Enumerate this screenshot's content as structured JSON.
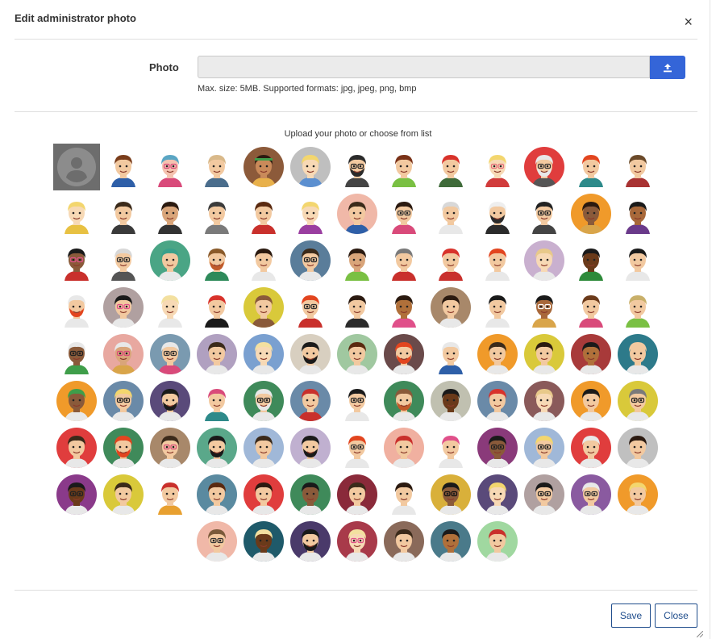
{
  "dialog": {
    "title": "Edit administrator photo",
    "close_glyph": "×"
  },
  "photo": {
    "label": "Photo",
    "hint": "Max. size: 5MB. Supported formats: jpg, jpeg, png, bmp",
    "upload_icon": "upload-icon"
  },
  "gallery": {
    "caption": "Upload your photo or choose from list",
    "row_counts": [
      13,
      13,
      13,
      13,
      13,
      13,
      13,
      13,
      7
    ],
    "avatars": [
      {
        "frame": "none",
        "bg": "#6d6d6d",
        "skin": "#ffffff",
        "hair": "#ffffff",
        "shirt": "#ffffff",
        "default": true
      },
      {
        "frame": "none",
        "bg": "#ffffff",
        "skin": "#f2c9a0",
        "hair": "#7a3d1b",
        "shirt": "#2e5fa8"
      },
      {
        "frame": "none",
        "bg": "#ffffff",
        "skin": "#f5c2b0",
        "hair": "#5aa6c4",
        "shirt": "#d94a7a",
        "glasses": "#d94a7a"
      },
      {
        "frame": "none",
        "bg": "#ffffff",
        "skin": "#f2c9a0",
        "hair": "#d9b98a",
        "shirt": "#4a6d8c"
      },
      {
        "frame": "circle",
        "bg": "#8c5a3a",
        "skin": "#c98a5a",
        "hair": "#2b1a10",
        "shirt": "#e8b04a",
        "band": "#3f9e4a"
      },
      {
        "frame": "circle",
        "bg": "#bfbfbf",
        "skin": "#f7d9b5",
        "hair": "#f3d66e",
        "shirt": "#5b8fd0"
      },
      {
        "frame": "none",
        "bg": "#ffffff",
        "skin": "#f2c9a0",
        "hair": "#2b2b2b",
        "shirt": "#444444",
        "beard": "#2b2b2b",
        "glasses": "#222222"
      },
      {
        "frame": "none",
        "bg": "#ffffff",
        "skin": "#f2c9a0",
        "hair": "#7a3218",
        "shirt": "#7ac043"
      },
      {
        "frame": "none",
        "bg": "#ffffff",
        "skin": "#f2c9a0",
        "hair": "#d8322b",
        "shirt": "#3f6b3a"
      },
      {
        "frame": "none",
        "bg": "#ffffff",
        "skin": "#f7d9b5",
        "hair": "#f3d66e",
        "shirt": "#d13b3b",
        "glasses": "#e66e7a"
      },
      {
        "frame": "circle",
        "bg": "#e03d3d",
        "skin": "#f2c9a0",
        "hair": "#e8e8e8",
        "shirt": "#555555",
        "glasses": "#333333",
        "beard": "#e8e8e8"
      },
      {
        "frame": "none",
        "bg": "#ffffff",
        "skin": "#f2c9a0",
        "hair": "#e2451f",
        "shirt": "#2d8a8a"
      },
      {
        "frame": "none",
        "bg": "#ffffff",
        "skin": "#f2c9a0",
        "hair": "#6b4a2a",
        "shirt": "#a83232"
      },
      {
        "frame": "none",
        "bg": "#ffffff",
        "skin": "#f7d9b5",
        "hair": "#f3d66e",
        "shirt": "#e8c142"
      },
      {
        "frame": "none",
        "bg": "#ffffff",
        "skin": "#f2c9a0",
        "hair": "#3b2a1a",
        "shirt": "#3a3a3a"
      },
      {
        "frame": "none",
        "bg": "#ffffff",
        "skin": "#d9a57a",
        "hair": "#2b1a10",
        "shirt": "#333333"
      },
      {
        "frame": "none",
        "bg": "#ffffff",
        "skin": "#f2c9a0",
        "hair": "#3b3b3b",
        "shirt": "#7a7a7a"
      },
      {
        "frame": "none",
        "bg": "#ffffff",
        "skin": "#f2c9a0",
        "hair": "#5a2a10",
        "shirt": "#c9302c"
      },
      {
        "frame": "none",
        "bg": "#ffffff",
        "skin": "#f7d9b5",
        "hair": "#f3d66e",
        "shirt": "#9a3ea0"
      },
      {
        "frame": "circle",
        "bg": "#f0b8a8",
        "skin": "#f2c9a0",
        "hair": "#3b2a1a",
        "shirt": "#2e5fa8"
      },
      {
        "frame": "none",
        "bg": "#ffffff",
        "skin": "#f2c9a0",
        "hair": "#2b1a10",
        "shirt": "#d94a7a",
        "glasses": "#333333"
      },
      {
        "frame": "none",
        "bg": "#ffffff",
        "skin": "#f2c9a0",
        "hair": "#d8d8d8",
        "shirt": "#e8e8e8"
      },
      {
        "frame": "none",
        "bg": "#ffffff",
        "skin": "#f2c9a0",
        "hair": "#eeeeee",
        "shirt": "#2b2b2b",
        "beard": "#2b2b2b"
      },
      {
        "frame": "none",
        "bg": "#ffffff",
        "skin": "#f2c9a0",
        "hair": "#222222",
        "shirt": "#444444",
        "glasses": "#222222"
      },
      {
        "frame": "circle",
        "bg": "#f09a2a",
        "skin": "#8a5a3a",
        "hair": "#2b1a10",
        "shirt": "#d9a54a"
      },
      {
        "frame": "none",
        "bg": "#ffffff",
        "skin": "#a8683a",
        "hair": "#1a1a1a",
        "shirt": "#6a3a8a"
      },
      {
        "frame": "none",
        "bg": "#ffffff",
        "skin": "#8a5a3a",
        "hair": "#1a1a1a",
        "shirt": "#c9302c",
        "glasses": "#e0508a"
      },
      {
        "frame": "none",
        "bg": "#ffffff",
        "skin": "#f2c9a0",
        "hair": "#d8d8d8",
        "shirt": "#555555",
        "glasses": "#333333"
      },
      {
        "frame": "circle",
        "bg": "#4aa585",
        "skin": "#f2c9a0",
        "hair": "#3aa08a",
        "shirt": "#e8e8e8"
      },
      {
        "frame": "none",
        "bg": "#ffffff",
        "skin": "#f2c9a0",
        "hair": "#8a5a2a",
        "shirt": "#2e8a5a",
        "beard": "#c05a2a"
      },
      {
        "frame": "none",
        "bg": "#ffffff",
        "skin": "#f2c9a0",
        "hair": "#2b1a10",
        "shirt": "#e8e8e8"
      },
      {
        "frame": "circle",
        "bg": "#5a7d9a",
        "skin": "#f2c9a0",
        "hair": "#3b2a1a",
        "shirt": "#e8e8e8",
        "glasses": "#222222"
      },
      {
        "frame": "none",
        "bg": "#ffffff",
        "skin": "#d9a57a",
        "hair": "#2b1a10",
        "shirt": "#7ac043"
      },
      {
        "frame": "none",
        "bg": "#ffffff",
        "skin": "#f2c9a0",
        "hair": "#7a7a7a",
        "shirt": "#c9302c"
      },
      {
        "frame": "none",
        "bg": "#ffffff",
        "skin": "#f2c9a0",
        "hair": "#d8322b",
        "shirt": "#c9302c"
      },
      {
        "frame": "none",
        "bg": "#ffffff",
        "skin": "#f2c9a0",
        "hair": "#e2451f",
        "shirt": "#e8e8e8"
      },
      {
        "frame": "circle",
        "bg": "#c9b0cf",
        "skin": "#f7d9b5",
        "hair": "#e8c98a",
        "shirt": "#e8e8e8"
      },
      {
        "frame": "none",
        "bg": "#ffffff",
        "skin": "#6a3a1a",
        "hair": "#1a1a1a",
        "shirt": "#2e8a3a"
      },
      {
        "frame": "none",
        "bg": "#ffffff",
        "skin": "#f2c9a0",
        "hair": "#1a1a1a",
        "shirt": "#e8e8e8"
      },
      {
        "frame": "none",
        "bg": "#ffffff",
        "skin": "#f2c9a0",
        "hair": "#e8e8e8",
        "shirt": "#e8e8e8",
        "beard": "#e2451f"
      },
      {
        "frame": "circle",
        "bg": "#b0a0a0",
        "skin": "#f2c9a0",
        "hair": "#1a1a1a",
        "shirt": "#e8e8e8",
        "glasses": "#e0508a"
      },
      {
        "frame": "none",
        "bg": "#ffffff",
        "skin": "#f7d9b5",
        "hair": "#f3e0a0",
        "shirt": "#e8e8e8"
      },
      {
        "frame": "none",
        "bg": "#ffffff",
        "skin": "#f2c9a0",
        "hair": "#d8322b",
        "shirt": "#1a1a1a"
      },
      {
        "frame": "circle",
        "bg": "#d9c93a",
        "skin": "#f2c9a0",
        "hair": "#8a5a3a",
        "shirt": "#8a5a3a"
      },
      {
        "frame": "none",
        "bg": "#ffffff",
        "skin": "#f2c9a0",
        "hair": "#e2451f",
        "shirt": "#c9302c",
        "glasses": "#333333"
      },
      {
        "frame": "none",
        "bg": "#ffffff",
        "skin": "#f2c9a0",
        "hair": "#2b1a10",
        "shirt": "#2b2b2b"
      },
      {
        "frame": "none",
        "bg": "#ffffff",
        "skin": "#b0703a",
        "hair": "#2b1a10",
        "shirt": "#e0508a"
      },
      {
        "frame": "circle",
        "bg": "#a8886a",
        "skin": "#f2c9a0",
        "hair": "#2b1a10",
        "shirt": "#e8e8e8"
      },
      {
        "frame": "none",
        "bg": "#ffffff",
        "skin": "#f2c9a0",
        "hair": "#1a1a1a",
        "shirt": "#e8e8e8"
      },
      {
        "frame": "none",
        "bg": "#ffffff",
        "skin": "#a8683a",
        "hair": "#1a1a1a",
        "shirt": "#d9a54a",
        "glasses": "#ffffff"
      },
      {
        "frame": "none",
        "bg": "#ffffff",
        "skin": "#f2c9a0",
        "hair": "#6b3a1a",
        "shirt": "#d94a7a"
      },
      {
        "frame": "none",
        "bg": "#ffffff",
        "skin": "#f2c9a0",
        "hair": "#c9b06a",
        "shirt": "#7ac043"
      },
      {
        "frame": "none",
        "bg": "#ffffff",
        "skin": "#8a5a3a",
        "hair": "#e8e8e8",
        "shirt": "#3f9e4a",
        "glasses": "#222222"
      },
      {
        "frame": "circle",
        "bg": "#e8a8a0",
        "skin": "#d9a57a",
        "hair": "#e8e8e8",
        "shirt": "#d9a54a",
        "glasses": "#d94a7a"
      },
      {
        "frame": "circle",
        "bg": "#7a9ab0",
        "skin": "#f2c9a0",
        "hair": "#e8e8e8",
        "shirt": "#d94a7a",
        "glasses": "#333333"
      },
      {
        "frame": "circle",
        "bg": "#b0a0c0",
        "skin": "#f2c9a0",
        "hair": "#3b2a1a",
        "shirt": "#e8e8e8"
      },
      {
        "frame": "circle",
        "bg": "#7aa0d0",
        "skin": "#f7d9b5",
        "hair": "#f3e0a0",
        "shirt": "#e8e8e8"
      },
      {
        "frame": "circle",
        "bg": "#d8cfc0",
        "skin": "#f2c9a0",
        "hair": "#1a1a1a",
        "shirt": "#e8e8e8",
        "beard": "#1a1a1a"
      },
      {
        "frame": "circle",
        "bg": "#a0c8a0",
        "skin": "#f2c9a0",
        "hair": "#5a2a10",
        "shirt": "#e8e8e8"
      },
      {
        "frame": "circle",
        "bg": "#6a4a4a",
        "skin": "#f2c9a0",
        "hair": "#e2451f",
        "shirt": "#e8e8e8",
        "beard": "#e2451f"
      },
      {
        "frame": "none",
        "bg": "#ffffff",
        "skin": "#f2c9a0",
        "hair": "#e8e8e8",
        "shirt": "#2e5fa8"
      },
      {
        "frame": "circle",
        "bg": "#f09a2a",
        "skin": "#f2c9a0",
        "hair": "#3b2a1a",
        "shirt": "#e8e8e8"
      },
      {
        "frame": "circle",
        "bg": "#d9c93a",
        "skin": "#f2c9a0",
        "hair": "#2b1a10",
        "shirt": "#e8e8e8"
      },
      {
        "frame": "circle",
        "bg": "#a83a3a",
        "skin": "#b0703a",
        "hair": "#1a1a1a",
        "shirt": "#e8e8e8"
      },
      {
        "frame": "circle",
        "bg": "#2d7a8a",
        "skin": "#f2c9a0",
        "hair": "#f2c9a0",
        "shirt": "#e8e8e8"
      },
      {
        "frame": "circle",
        "bg": "#f09a2a",
        "skin": "#8a5a3a",
        "hair": "#3f9e4a",
        "shirt": "#e8e8e8"
      },
      {
        "frame": "circle",
        "bg": "#6a8aa8",
        "skin": "#f2c9a0",
        "hair": "#f3d66e",
        "shirt": "#e8e8e8",
        "glasses": "#222222"
      },
      {
        "frame": "circle",
        "bg": "#5a4a7a",
        "skin": "#f2c9a0",
        "hair": "#1a1a1a",
        "shirt": "#e8e8e8",
        "beard": "#1a1a1a"
      },
      {
        "frame": "none",
        "bg": "#ffffff",
        "skin": "#f2c9a0",
        "hair": "#d94a7a",
        "shirt": "#2e8a8a"
      },
      {
        "frame": "circle",
        "bg": "#3f8a5a",
        "skin": "#f2c9a0",
        "hair": "#e8e8e8",
        "shirt": "#e8e8e8",
        "glasses": "#222222",
        "beard": "#e8e8e8"
      },
      {
        "frame": "circle",
        "bg": "#6a8aa8",
        "skin": "#f2c9a0",
        "hair": "#c9302c",
        "shirt": "#c9302c"
      },
      {
        "frame": "none",
        "bg": "#ffffff",
        "skin": "#f2c9a0",
        "hair": "#1a1a1a",
        "shirt": "#e8e8e8",
        "glasses": "#222222"
      },
      {
        "frame": "circle",
        "bg": "#3f8a5a",
        "skin": "#f2c9a0",
        "hair": "#8a5a3a",
        "shirt": "#e8e8e8",
        "beard": "#c05a2a"
      },
      {
        "frame": "circle",
        "bg": "#c0c0b0",
        "skin": "#6a3a1a",
        "hair": "#1a1a1a",
        "shirt": "#e8e8e8"
      },
      {
        "frame": "circle",
        "bg": "#6a8aa8",
        "skin": "#f2c9a0",
        "hair": "#d8322b",
        "shirt": "#e8e8e8"
      },
      {
        "frame": "circle",
        "bg": "#8a5a5a",
        "skin": "#f7d9b5",
        "hair": "#e8c98a",
        "shirt": "#e8e8e8"
      },
      {
        "frame": "circle",
        "bg": "#f09a2a",
        "skin": "#f2c9a0",
        "hair": "#1a1a1a",
        "shirt": "#e8e8e8"
      },
      {
        "frame": "circle",
        "bg": "#d9c93a",
        "skin": "#f2c9a0",
        "hair": "#7a7a7a",
        "shirt": "#e8e8e8",
        "glasses": "#222222"
      },
      {
        "frame": "circle",
        "bg": "#e03d3d",
        "skin": "#f2c9a0",
        "hair": "#3b2a1a",
        "shirt": "#e8e8e8"
      },
      {
        "frame": "circle",
        "bg": "#3f8a5a",
        "skin": "#f2c9a0",
        "hair": "#e2451f",
        "shirt": "#e8e8e8",
        "beard": "#e2451f"
      },
      {
        "frame": "circle",
        "bg": "#a8886a",
        "skin": "#f2c9a0",
        "hair": "#3b2a1a",
        "shirt": "#e8e8e8",
        "glasses": "#d94a7a"
      },
      {
        "frame": "circle",
        "bg": "#5aa88a",
        "skin": "#f2c9a0",
        "hair": "#1a1a1a",
        "shirt": "#e8e8e8",
        "beard": "#1a1a1a"
      },
      {
        "frame": "circle",
        "bg": "#a0b8d8",
        "skin": "#f2c9a0",
        "hair": "#3b2a1a",
        "shirt": "#e8e8e8"
      },
      {
        "frame": "circle",
        "bg": "#c0b0d0",
        "skin": "#f2c9a0",
        "hair": "#1a1a1a",
        "shirt": "#e8e8e8",
        "beard": "#1a1a1a"
      },
      {
        "frame": "none",
        "bg": "#ffffff",
        "skin": "#f2c9a0",
        "hair": "#e2451f",
        "shirt": "#e8e8e8",
        "glasses": "#333333"
      },
      {
        "frame": "circle",
        "bg": "#f0b0a0",
        "skin": "#f2c9a0",
        "hair": "#c9302c",
        "shirt": "#e8e8e8"
      },
      {
        "frame": "none",
        "bg": "#ffffff",
        "skin": "#f2c9a0",
        "hair": "#e0508a",
        "shirt": "#e8e8e8"
      },
      {
        "frame": "circle",
        "bg": "#8a3a7a",
        "skin": "#8a5a3a",
        "hair": "#1a1a1a",
        "shirt": "#e8e8e8",
        "glasses": "#222222"
      },
      {
        "frame": "circle",
        "bg": "#a0b8d8",
        "skin": "#f2c9a0",
        "hair": "#f3d66e",
        "shirt": "#e8e8e8",
        "glasses": "#222222"
      },
      {
        "frame": "circle",
        "bg": "#e03d3d",
        "skin": "#f2c9a0",
        "hair": "#e8e8e8",
        "shirt": "#e8e8e8"
      },
      {
        "frame": "circle",
        "bg": "#c0c0c0",
        "skin": "#f2c9a0",
        "hair": "#2b1a10",
        "shirt": "#e8e8e8"
      },
      {
        "frame": "circle",
        "bg": "#8a3a8a",
        "skin": "#6a3a1a",
        "hair": "#1a1a1a",
        "shirt": "#e8e8e8",
        "glasses": "#222222"
      },
      {
        "frame": "circle",
        "bg": "#d9c93a",
        "skin": "#f2c9a0",
        "hair": "#3b2a1a",
        "shirt": "#e8e8e8"
      },
      {
        "frame": "none",
        "bg": "#ffffff",
        "skin": "#f2c9a0",
        "hair": "#c9302c",
        "shirt": "#e8a030"
      },
      {
        "frame": "circle",
        "bg": "#5a8aa0",
        "skin": "#f2c9a0",
        "hair": "#5a2a10",
        "shirt": "#e8e8e8"
      },
      {
        "frame": "circle",
        "bg": "#e03d3d",
        "skin": "#f2c9a0",
        "hair": "#2b1a10",
        "shirt": "#e8e8e8"
      },
      {
        "frame": "circle",
        "bg": "#3f8a5a",
        "skin": "#8a5a3a",
        "hair": "#1a1a1a",
        "shirt": "#e8e8e8"
      },
      {
        "frame": "circle",
        "bg": "#8a2a3a",
        "skin": "#f2c9a0",
        "hair": "#3b2a1a",
        "shirt": "#e8e8e8"
      },
      {
        "frame": "none",
        "bg": "#ffffff",
        "skin": "#f2c9a0",
        "hair": "#2b1a10",
        "shirt": "#e8e8e8"
      },
      {
        "frame": "circle",
        "bg": "#d9b03a",
        "skin": "#8a5a3a",
        "hair": "#1a1a1a",
        "shirt": "#e8e8e8",
        "glasses": "#111111"
      },
      {
        "frame": "circle",
        "bg": "#5a4a7a",
        "skin": "#f7d9b5",
        "hair": "#f3d66e",
        "shirt": "#e8e8e8"
      },
      {
        "frame": "circle",
        "bg": "#b0a0a0",
        "skin": "#f2c9a0",
        "hair": "#1a1a1a",
        "shirt": "#e8e8e8",
        "glasses": "#222222"
      },
      {
        "frame": "circle",
        "bg": "#8a5aa0",
        "skin": "#f2c9a0",
        "hair": "#e8e8e8",
        "shirt": "#e8e8e8",
        "glasses": "#333333"
      },
      {
        "frame": "circle",
        "bg": "#f09a2a",
        "skin": "#f2c9a0",
        "hair": "#f3d66e",
        "shirt": "#e8e8e8"
      },
      {
        "frame": "circle",
        "bg": "#f0b8a8",
        "skin": "#f2c9a0",
        "hair": "#7a5a3a",
        "shirt": "#e8e8e8",
        "glasses": "#333333"
      },
      {
        "frame": "circle",
        "bg": "#1f5a6a",
        "skin": "#6a3a1a",
        "hair": "#f3e0a0",
        "shirt": "#e8e8e8"
      },
      {
        "frame": "circle",
        "bg": "#4a3a6a",
        "skin": "#f2c9a0",
        "hair": "#1a1a1a",
        "shirt": "#e8e8e8",
        "beard": "#1a1a1a"
      },
      {
        "frame": "circle",
        "bg": "#a83a4a",
        "skin": "#f7d9b5",
        "hair": "#f3e0a0",
        "shirt": "#e8e8e8",
        "glasses": "#e0508a"
      },
      {
        "frame": "circle",
        "bg": "#8a6a5a",
        "skin": "#f2c9a0",
        "hair": "#3b2a1a",
        "shirt": "#e8e8e8"
      },
      {
        "frame": "circle",
        "bg": "#4a7a8a",
        "skin": "#b0703a",
        "hair": "#1a1a1a",
        "shirt": "#e8e8e8"
      },
      {
        "frame": "circle",
        "bg": "#a0d8a0",
        "skin": "#f2c9a0",
        "hair": "#c9302c",
        "shirt": "#e8e8e8"
      }
    ]
  },
  "footer": {
    "save_label": "Save",
    "close_label": "Close"
  }
}
